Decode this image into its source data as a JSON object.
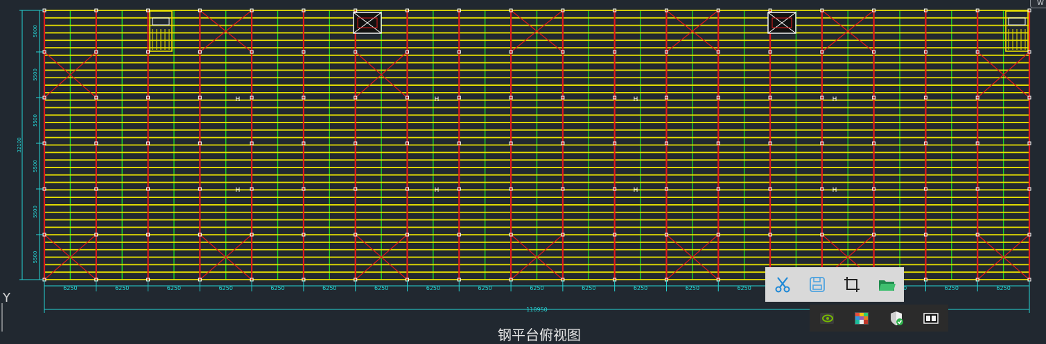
{
  "drawing": {
    "bay_labels": [
      "6250",
      "6250",
      "6250",
      "6250",
      "6250",
      "6250",
      "6250",
      "6250",
      "6250",
      "6250",
      "6250",
      "6250",
      "6250",
      "6250",
      "6250",
      "6250",
      "6250",
      "6250",
      "6250"
    ],
    "total_length_label": "118950",
    "left_span_labels": [
      "5000",
      "5500",
      "5500",
      "5500",
      "5500",
      "5500"
    ],
    "total_height_label": "32100",
    "axis_label": "Y",
    "view_title": "钢平台俯视图",
    "corner_tab_label": "W",
    "hoist_marker": "H",
    "colors": {
      "background": "#212830",
      "yellow_beam": "#e8e000",
      "red_frame": "#e01a1a",
      "green_joist": "#1ed41e",
      "dimension_cyan": "#25d6d6",
      "node": "#ffffff"
    }
  },
  "screenshot_toolbar": {
    "buttons": [
      {
        "name": "scissors-icon",
        "tooltip": "Cut"
      },
      {
        "name": "save-icon",
        "tooltip": "Save"
      },
      {
        "name": "crop-icon",
        "tooltip": "Crop"
      },
      {
        "name": "folder-icon",
        "tooltip": "Open folder"
      }
    ]
  },
  "taskbar_tray": {
    "icons": [
      "nvidia-icon",
      "color-palette-icon",
      "shield-check-icon",
      "window-icon"
    ]
  }
}
